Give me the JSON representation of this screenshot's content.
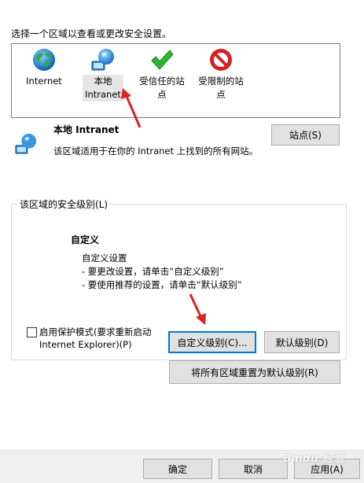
{
  "prompt": "选择一个区域以查看或更改安全设置。",
  "zones": [
    {
      "label": "Internet",
      "icon": "globe-icon"
    },
    {
      "label": "本地\nIntranet",
      "icon": "intranet-globe-icon"
    },
    {
      "label": "受信任的站\n点",
      "icon": "green-checkmark-icon"
    },
    {
      "label": "受限制的站\n点",
      "icon": "red-no-entry-icon"
    }
  ],
  "selected_zone": {
    "title": "本地 Intranet",
    "description": "该区域适用于在你的 Intranet 上找到的所有网站。",
    "sites_button": "站点(S)"
  },
  "security_level": {
    "group_label": "该区域的安全级别(L)",
    "level_name": "自定义",
    "desc_line1": "自定义设置",
    "desc_line2": "- 要更改设置，请单击“自定义级别”",
    "desc_line3": "- 要使用推荐的设置，请单击“默认级别”",
    "protected_mode_line1": "启用保护模式(要求重新启动",
    "protected_mode_line2": "Internet Explorer)(P)",
    "protected_mode_checked": false,
    "custom_level_button": "自定义级别(C)...",
    "default_level_button": "默认级别(D)"
  },
  "reset_button": "将所有区域重置为默认级别(R)",
  "footer": {
    "ok": "确定",
    "cancel": "取消",
    "apply": "应用(A)"
  },
  "watermark": "Baidu 经验",
  "colors": {
    "annotation_arrow": "#e02020",
    "focus_border": "#0078d7",
    "button_bg": "#e1e1e1"
  }
}
